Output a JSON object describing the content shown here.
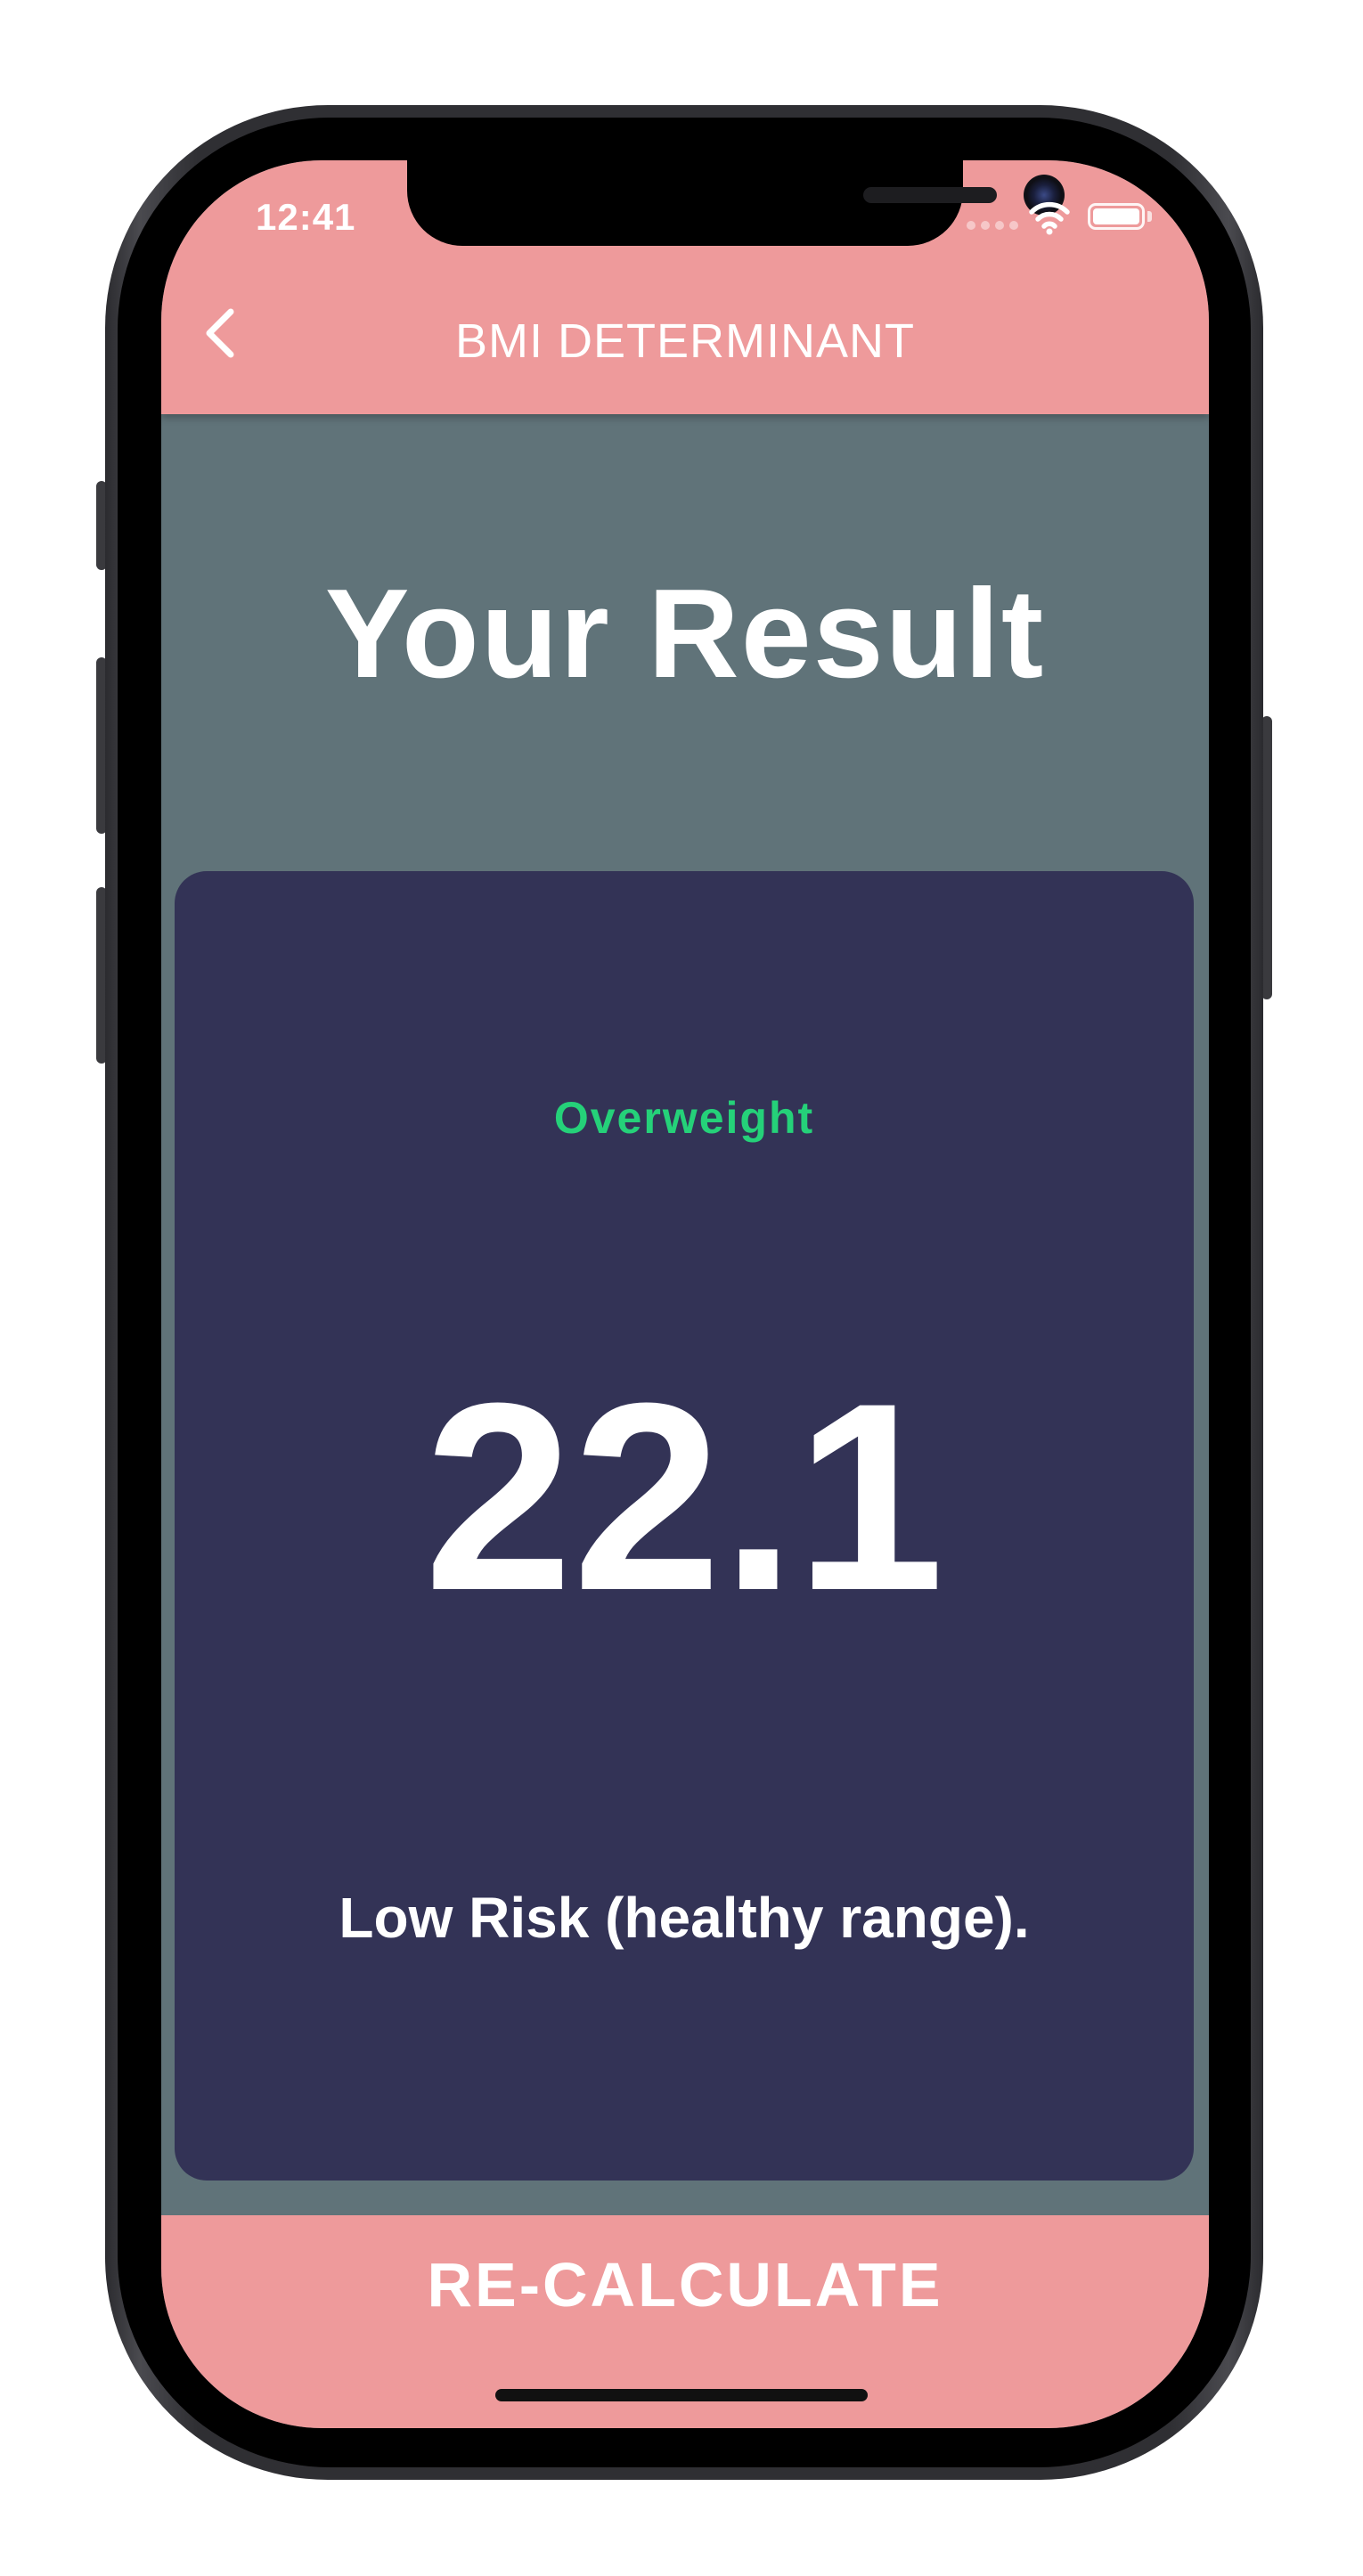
{
  "status_bar": {
    "time": "12:41",
    "wifi_icon": "wifi-icon",
    "battery_icon": "battery-icon",
    "signal_icon": "cellular-signal-icon"
  },
  "app_bar": {
    "back_icon": "chevron-left-icon",
    "title": "BMI DETERMINANT"
  },
  "page": {
    "title": "Your Result"
  },
  "result_card": {
    "category": "Overweight",
    "bmi": "22.1",
    "interpretation": "Low Risk (healthy range)."
  },
  "actions": {
    "recalculate_label": "RE-CALCULATE"
  },
  "colors": {
    "accent": "#EE9A9B",
    "background": "#607379",
    "card": "#333356",
    "category_text": "#25D179",
    "text": "#FFFFFF"
  }
}
